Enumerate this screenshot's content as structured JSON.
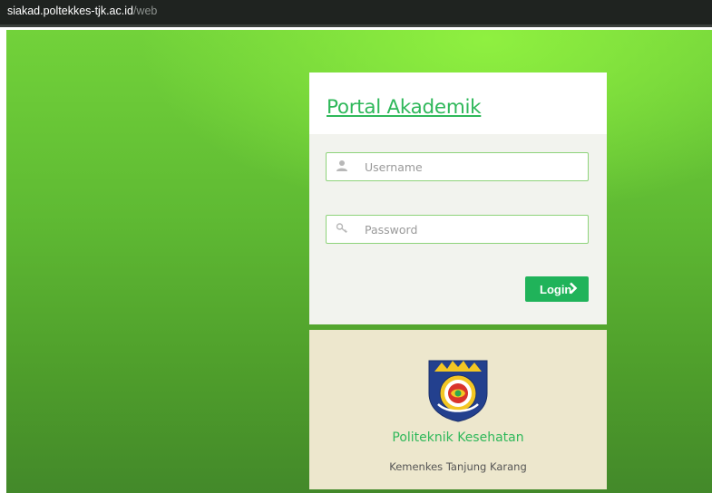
{
  "browser": {
    "url_host": "siakad.poltekkes-tjk.ac.id",
    "url_path": "/web"
  },
  "portal": {
    "title": "Portal Akademik"
  },
  "login_form": {
    "username": {
      "placeholder": "Username",
      "value": "",
      "icon": "user-icon"
    },
    "password": {
      "placeholder": "Password",
      "value": "",
      "icon": "key-icon"
    },
    "submit_label": "Login",
    "submit_icon": "chevron-right-icon"
  },
  "institution": {
    "name": "Politeknik Kesehatan",
    "subtitle": "Kemenkes Tanjung Karang",
    "logo": "institution-logo"
  },
  "colors": {
    "accent": "#20b35a",
    "background_green": "#5fba33",
    "footer_panel": "#ede7cd"
  }
}
